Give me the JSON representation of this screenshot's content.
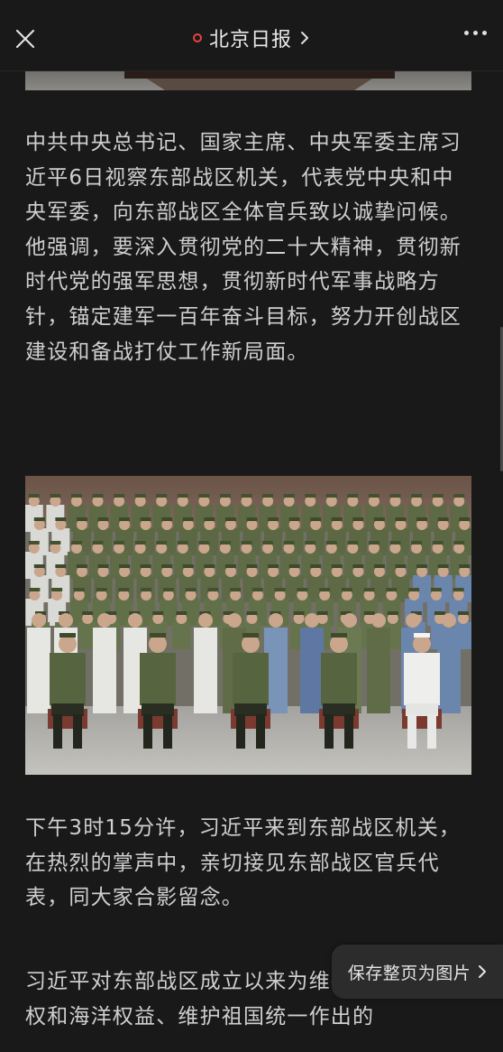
{
  "nav": {
    "title": "北京日报",
    "close_icon": "close-icon",
    "more_icon": "more-icon",
    "source_icon": "source-dot-icon",
    "accent_color": "#e64340"
  },
  "article": {
    "paragraph_1": "中共中央总书记、国家主席、中央军委主席习近平6日视察东部战区机关，代表党中央和中央军委，向东部战区全体官兵致以诚挚问候。他强调，要深入贯彻党的二十大精神，贯彻新时代党的强军思想，贯彻新时代军事战略方针，锚定建军一百年奋斗目标，努力开创战区建设和备战打仗工作新局面。",
    "paragraph_2": "下午3时15分许，习近平来到东部战区机关，在热烈的掌声中，亲切接见东部战区官兵代表，同大家合影留念。",
    "paragraph_3": "习近平对东部战区成立以来为维护国家领土主权和海洋权益、维护祖国统一作出的"
  },
  "save_page": {
    "label": "保存整页为图片",
    "icon": "chevron-right-icon"
  }
}
